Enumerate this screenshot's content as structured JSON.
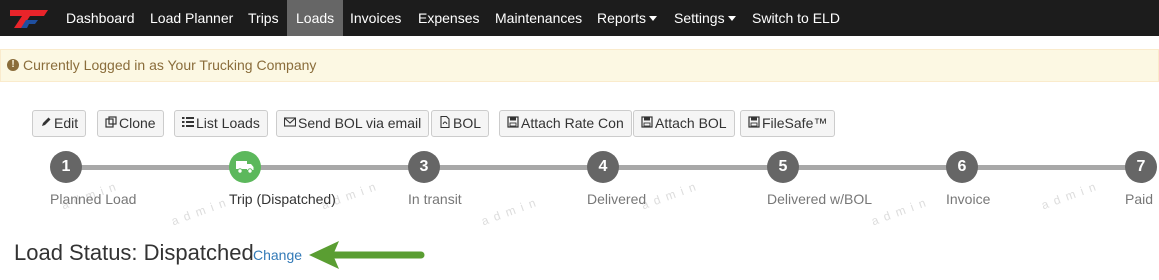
{
  "navbar": {
    "logo": "logo-icon",
    "items": [
      {
        "label": "Dashboard"
      },
      {
        "label": "Load Planner"
      },
      {
        "label": "Trips"
      },
      {
        "label": "Loads"
      },
      {
        "label": "Invoices"
      },
      {
        "label": "Expenses"
      },
      {
        "label": "Maintenances"
      },
      {
        "label": "Reports"
      },
      {
        "label": "Settings"
      },
      {
        "label": "Switch to ELD"
      }
    ],
    "active": "Loads"
  },
  "alert": {
    "text": "Currently Logged in as Your Trucking Company",
    "icon": "exclamation-circle-icon",
    "background": "#fcf8e3"
  },
  "toolbar": {
    "buttons": [
      {
        "label": "Edit",
        "icon": "pencil-icon"
      },
      {
        "label": "Clone",
        "icon": "clone-icon"
      },
      {
        "label": "List Loads",
        "icon": "list-icon"
      },
      {
        "label": "Send BOL via email",
        "icon": "envelope-icon"
      },
      {
        "label": "BOL",
        "icon": "pdf-icon"
      },
      {
        "label": "Attach Rate Con",
        "icon": "save-icon"
      },
      {
        "label": "Attach BOL",
        "icon": "save-icon"
      },
      {
        "label": "FileSafe™",
        "icon": "save-icon"
      }
    ]
  },
  "steps": {
    "items": [
      {
        "number": "1",
        "label": "Planned Load"
      },
      {
        "number": "",
        "label": "Trip (Dispatched)",
        "icon": "truck-icon"
      },
      {
        "number": "3",
        "label": "In transit"
      },
      {
        "number": "4",
        "label": "Delivered"
      },
      {
        "number": "5",
        "label": "Delivered w/BOL"
      },
      {
        "number": "6",
        "label": "Invoice"
      },
      {
        "number": "7",
        "label": "Paid"
      }
    ],
    "current": "Trip (Dispatched)",
    "active_color": "#5cb85c"
  },
  "watermark": "admin",
  "status": {
    "text": "Load Status: Dispatched",
    "change_label": "Change"
  },
  "colors": {
    "navbar": "#1c1c1c",
    "link": "#337ab7",
    "arrow": "#5a9e32"
  }
}
